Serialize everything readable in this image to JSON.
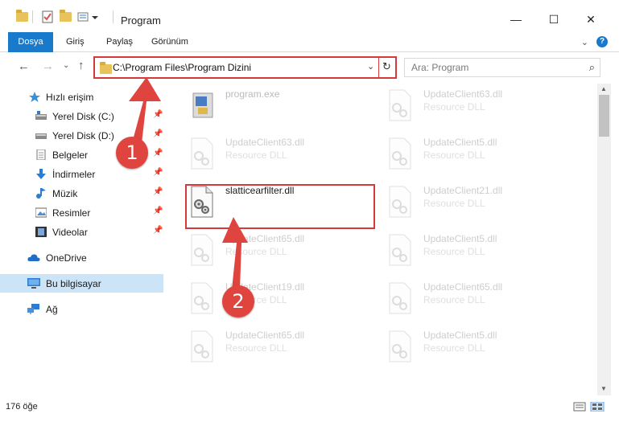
{
  "window": {
    "title": "Program",
    "minimize": "—",
    "maximize": "☐",
    "close": "✕"
  },
  "ribbon": {
    "tabs": [
      "Dosya",
      "Giriş",
      "Paylaş",
      "Görünüm"
    ],
    "help": "?",
    "collapse": "⌄"
  },
  "address": {
    "path": "C:\\Program Files\\Program Dizini",
    "dropdown": "⌄",
    "refresh": "↻"
  },
  "search": {
    "placeholder": "Ara: Program",
    "icon": "⌕"
  },
  "nav_buttons": {
    "back": "←",
    "forward": "→",
    "recent": "⌄",
    "up": "↑"
  },
  "sidebar": {
    "items": [
      {
        "label": "Hızlı erişim",
        "icon": "star-icon",
        "pinned": false
      },
      {
        "label": "Yerel Disk (C:)",
        "icon": "drive-icon",
        "pinned": true
      },
      {
        "label": "Yerel Disk (D:)",
        "icon": "drive-icon",
        "pinned": true
      },
      {
        "label": "Belgeler",
        "icon": "documents-icon",
        "pinned": true
      },
      {
        "label": "İndirmeler",
        "icon": "download-icon",
        "pinned": true
      },
      {
        "label": "Müzik",
        "icon": "music-icon",
        "pinned": true
      },
      {
        "label": "Resimler",
        "icon": "pictures-icon",
        "pinned": true
      },
      {
        "label": "Videolar",
        "icon": "videos-icon",
        "pinned": true
      },
      {
        "label": "OneDrive",
        "icon": "cloud-icon",
        "pinned": false
      },
      {
        "label": "Bu bilgisayar",
        "icon": "computer-icon",
        "pinned": false
      },
      {
        "label": "Ağ",
        "icon": "network-icon",
        "pinned": false
      }
    ],
    "pin_glyph": "📌"
  },
  "files": {
    "left": [
      {
        "name": "program.exe",
        "type": ""
      },
      {
        "name": "UpdateClient63.dll",
        "type": "Resource DLL"
      },
      {
        "name": "slatticearfilter.dll",
        "type": ""
      },
      {
        "name": "UpdateClient65.dll",
        "type": "Resource DLL"
      },
      {
        "name": "UpdateClient19.dll",
        "type": "Resource DLL"
      },
      {
        "name": "UpdateClient65.dll",
        "type": "Resource DLL"
      }
    ],
    "right": [
      {
        "name": "UpdateClient63.dll",
        "type": "Resource DLL"
      },
      {
        "name": "UpdateClient5.dll",
        "type": "Resource DLL"
      },
      {
        "name": "UpdateClient21.dll",
        "type": "Resource DLL"
      },
      {
        "name": "UpdateClient5.dll",
        "type": "Resource DLL"
      },
      {
        "name": "UpdateClient65.dll",
        "type": "Resource DLL"
      },
      {
        "name": "UpdateClient5.dll",
        "type": "Resource DLL"
      }
    ]
  },
  "status": {
    "item_count": "176 öğe"
  },
  "annotations": {
    "step1": "1",
    "step2": "2",
    "color": "#e0443e"
  },
  "colors": {
    "accent": "#1979ca",
    "selection": "#cce4f7",
    "highlight_border": "#d43a3a"
  }
}
